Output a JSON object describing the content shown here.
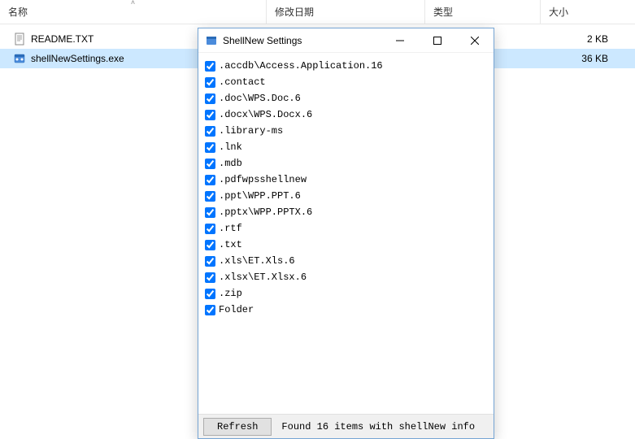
{
  "explorer": {
    "columns": {
      "name": "名称",
      "date": "修改日期",
      "type": "类型",
      "size": "大小"
    },
    "files": [
      {
        "name": "README.TXT",
        "icon": "text",
        "size": "2 KB",
        "selected": false
      },
      {
        "name": "shellNewSettings.exe",
        "icon": "exe",
        "size": "36 KB",
        "selected": true
      }
    ]
  },
  "shellnew": {
    "title": "ShellNew Settings",
    "items": [
      ".accdb\\Access.Application.16",
      ".contact",
      ".doc\\WPS.Doc.6",
      ".docx\\WPS.Docx.6",
      ".library-ms",
      ".lnk",
      ".mdb",
      ".pdfwpsshellnew",
      ".ppt\\WPP.PPT.6",
      ".pptx\\WPP.PPTX.6",
      ".rtf",
      ".txt",
      ".xls\\ET.Xls.6",
      ".xlsx\\ET.Xlsx.6",
      ".zip",
      "Folder"
    ],
    "refresh_label": "Refresh",
    "status_text": "Found 16 items with shellNew info"
  }
}
